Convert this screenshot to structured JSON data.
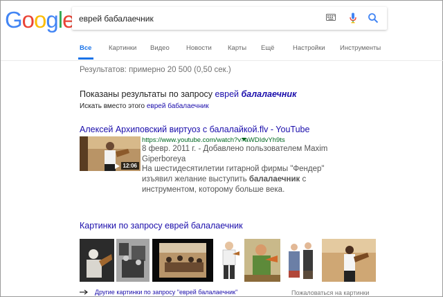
{
  "logo": {
    "letters": [
      "G",
      "o",
      "o",
      "g",
      "l",
      "e"
    ]
  },
  "search": {
    "query": "еврей бабалаечник"
  },
  "tabs": [
    {
      "label": "Все"
    },
    {
      "label": "Картинки"
    },
    {
      "label": "Видео"
    },
    {
      "label": "Новости"
    },
    {
      "label": "Карты"
    },
    {
      "label": "Ещё"
    },
    {
      "label": "Настройки"
    },
    {
      "label": "Инструменты"
    }
  ],
  "stats": "Результатов: примерно 20 500 (0,50 сек.)",
  "spelling": {
    "showing_prefix": "Показаны результаты по запросу ",
    "corrected_plain": "еврей",
    "corrected_bold": "балалаечник",
    "instead_prefix": "Искать вместо этого ",
    "original_query": "еврей бабалаечник"
  },
  "result": {
    "title": "Алексей Архиповский виртуоз с балалайкой.flv - YouTube",
    "url": "https://www.youtube.com/watch?v=aWDIdvYh9ts",
    "duration": "12:06",
    "date_line": "8 февр. 2011 г. - Добавлено пользователем Maxim Giperboreya",
    "snippet_1": "На шестидесятилетии гитарной фирмы \"Фендер\" изъявил желание выступить ",
    "snippet_bold": "балалаечник",
    "snippet_2": " с инструментом, которому больше века."
  },
  "images": {
    "title": "Картинки по запросу еврей балалаечник",
    "more_label": "Другие картинки по запросу \"еврей балалаечник\"",
    "report_label": "Пожаловаться на картинки"
  },
  "colors": {
    "link": "#1a0dab",
    "url_green": "#006621",
    "accent_blue": "#1a73e8"
  }
}
